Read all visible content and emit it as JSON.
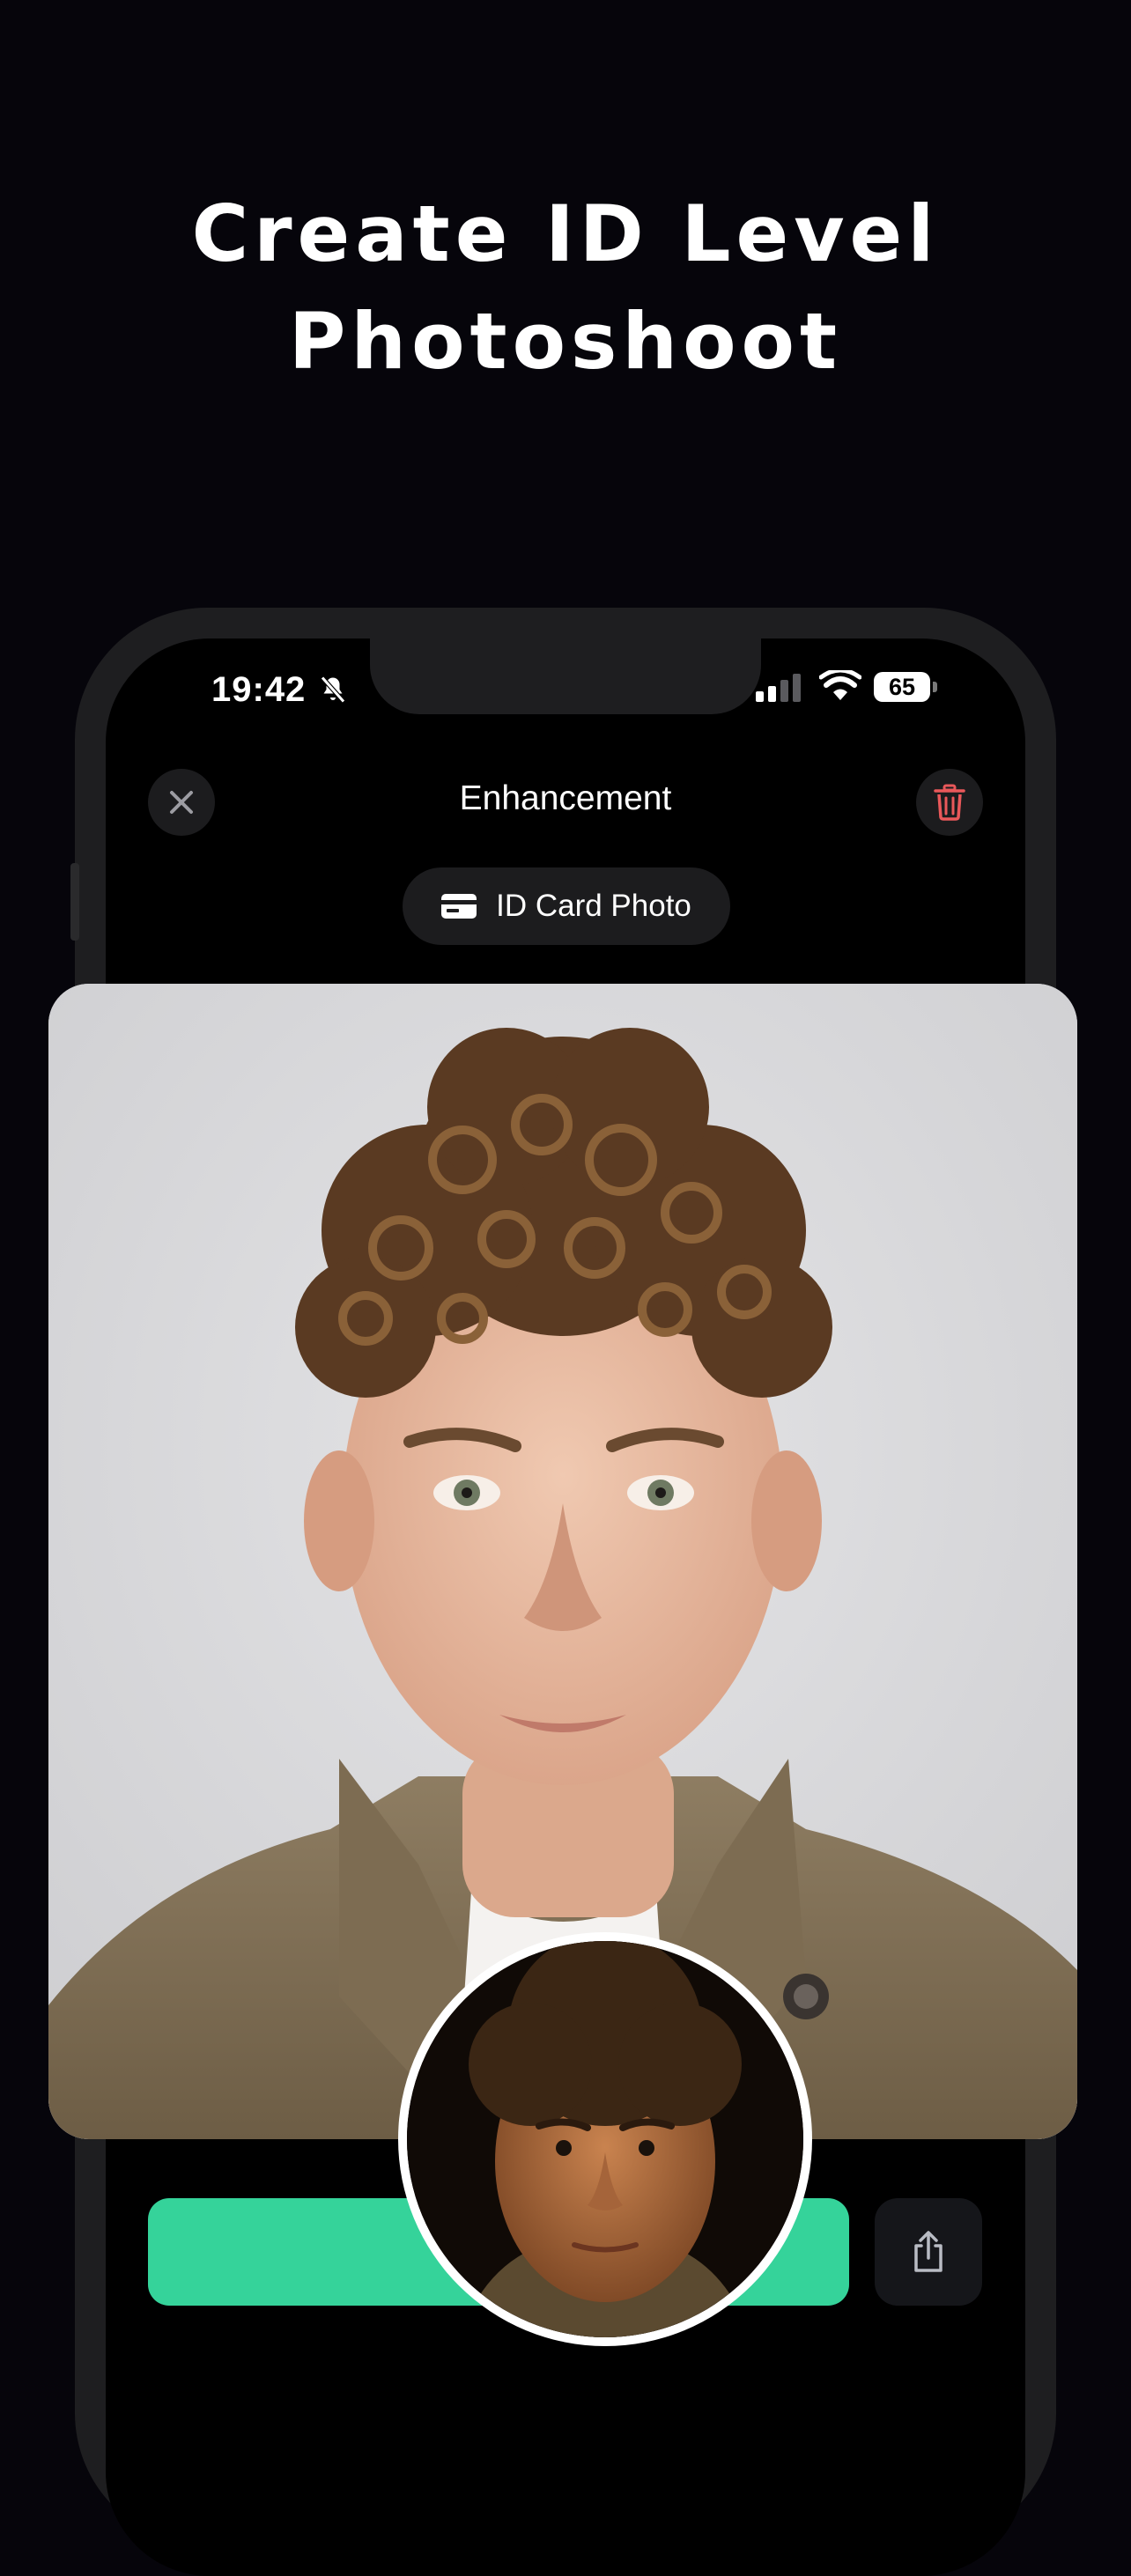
{
  "headline": {
    "line1": "Create ID Level",
    "line2": "Photoshoot"
  },
  "status_bar": {
    "time": "19:42",
    "battery": "65"
  },
  "header": {
    "title": "Enhancement"
  },
  "mode_pill": {
    "label": "ID Card Photo",
    "icon": "id-card-icon"
  },
  "icons": {
    "close": "close-icon",
    "delete": "trash-icon",
    "share": "share-icon",
    "silent": "bell-slash-icon",
    "signal": "cellular-signal-icon",
    "wifi": "wifi-icon"
  },
  "colors": {
    "background": "#06050b",
    "cta": "#35d39a",
    "trash": "#e9585a",
    "surface": "#1c1c1e"
  }
}
